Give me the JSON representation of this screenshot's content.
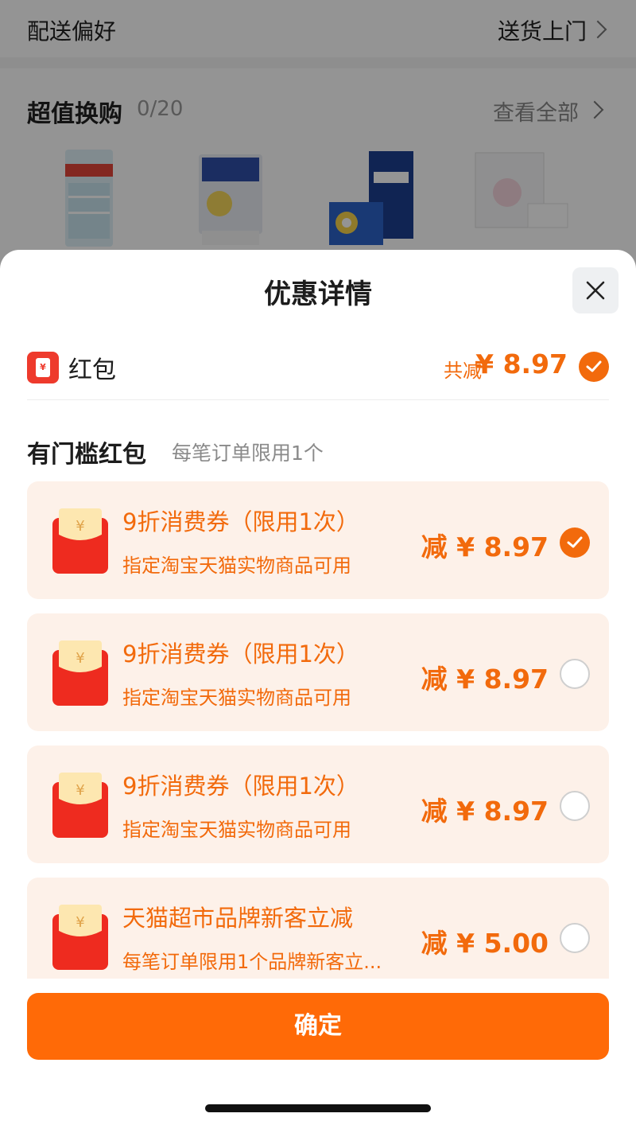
{
  "background": {
    "delivery": {
      "label": "配送偏好",
      "value": "送货上门"
    },
    "exchange": {
      "title": "超值换购",
      "count": "0/20",
      "view_all": "查看全部"
    }
  },
  "sheet": {
    "title": "优惠详情",
    "red_packet": {
      "label": "红包",
      "total_label": "共减",
      "total_value": "¥ 8.97",
      "icon_symbol": "¥"
    },
    "section": {
      "title": "有门槛红包",
      "note": "每笔订单限用1个"
    },
    "coupons": [
      {
        "title": "9折消费券（限用1次）",
        "subtitle": "指定淘宝天猫实物商品可用",
        "amount": "减 ¥ 8.97",
        "selected": true
      },
      {
        "title": "9折消费券（限用1次）",
        "subtitle": "指定淘宝天猫实物商品可用",
        "amount": "减 ¥ 8.97",
        "selected": false
      },
      {
        "title": "9折消费券（限用1次）",
        "subtitle": "指定淘宝天猫实物商品可用",
        "amount": "减 ¥ 8.97",
        "selected": false
      },
      {
        "title": "天猫超市品牌新客立减",
        "subtitle": "每笔订单限用1个品牌新客立...",
        "amount": "减 ¥ 5.00",
        "selected": false
      }
    ],
    "confirm_label": "确定"
  },
  "colors": {
    "accent": "#f26a0c",
    "button": "#ff6a07",
    "coupon_bg": "#fdf1e9",
    "red_packet": "#ee3a2c"
  }
}
